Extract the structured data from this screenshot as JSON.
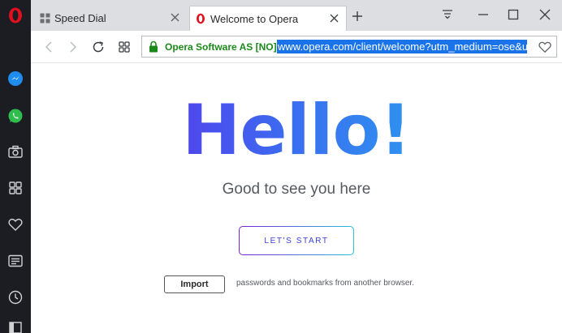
{
  "tabs": [
    {
      "title": "Speed Dial",
      "icon": "speed-dial-icon",
      "active": false
    },
    {
      "title": "Welcome to Opera",
      "icon": "opera-logo-icon",
      "active": true
    }
  ],
  "address_bar": {
    "security_label": "Opera Software AS [NO]",
    "url": "www.opera.com/client/welcome?utm_medium=ose&utm_source=welcome"
  },
  "sidebar": {
    "items": [
      "messenger-icon",
      "whatsapp-icon",
      "camera-icon",
      "speed-dial-icon",
      "heart-icon",
      "news-icon",
      "history-icon",
      "sidebar-toggle-icon"
    ]
  },
  "page": {
    "heading": "Hello!",
    "subtitle": "Good to see you here",
    "start_label": "LET'S START",
    "import_label": "Import",
    "import_text": "passwords and bookmarks from another browser."
  },
  "colors": {
    "opera_red": "#e0101e",
    "secure_green": "#1b8a1b",
    "url_highlight": "#1a73e8",
    "gradient_start": "#6a10e8",
    "gradient_end": "#1fc0f0"
  }
}
